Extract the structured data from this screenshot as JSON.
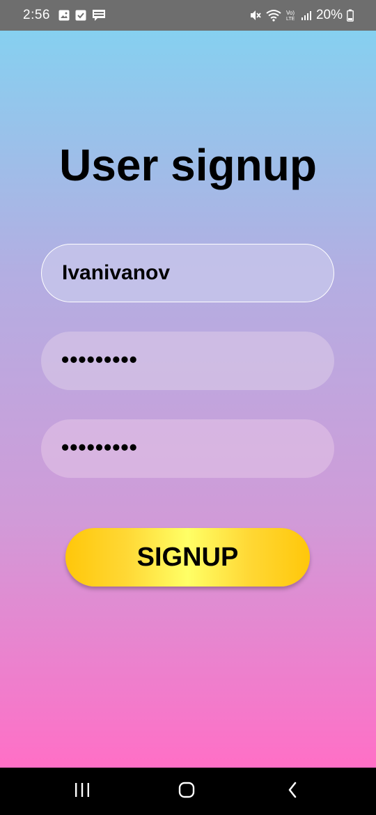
{
  "status_bar": {
    "time": "2:56",
    "battery": "20%",
    "left_icons": [
      "gallery-icon",
      "checkbox-icon",
      "webtoon-icon"
    ],
    "right_icons": [
      "mute-icon",
      "wifi-icon",
      "volte-icon",
      "signal-icon",
      "battery-icon"
    ]
  },
  "form": {
    "title": "User signup",
    "username_value": "Ivanivanov",
    "password_value": "•••••••••",
    "confirm_password_value": "•••••••••",
    "signup_label": "SIGNUP"
  },
  "colors": {
    "gradient_top": "#86d0f0",
    "gradient_bottom": "#ff6fc6",
    "button_yellow": "#ffd835",
    "button_highlight": "#ffff66"
  },
  "nav_bar": {
    "buttons": [
      "recents-icon",
      "home-icon",
      "back-icon"
    ]
  }
}
